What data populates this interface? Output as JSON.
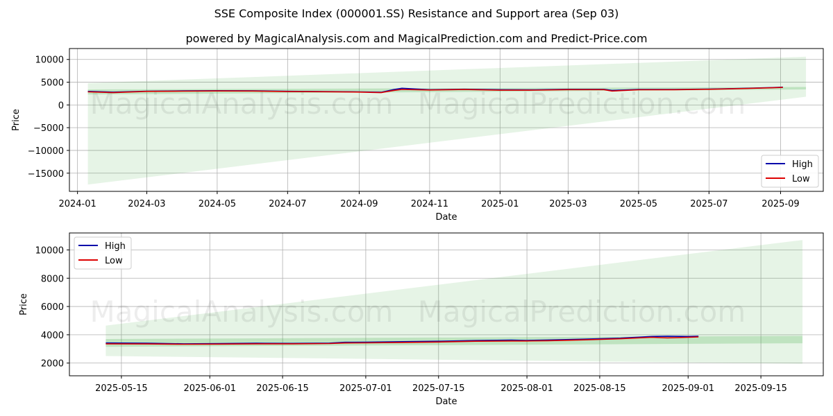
{
  "title": "SSE Composite Index (000001.SS) Resistance and Support area (Sep 03)",
  "subtitle": "powered by MagicalAnalysis.com and MagicalPrediction.com and Predict-Price.com",
  "watermarks": [
    "MagicalAnalysis.com",
    "MagicalPrediction.com"
  ],
  "colors": {
    "high": "#0000aa",
    "low": "#dd0000",
    "band": "#4caf50",
    "grid": "#b0b0b0"
  },
  "chart_data": [
    {
      "type": "line",
      "xlabel": "Date",
      "ylabel": "Price",
      "xlim": [
        "2023-12-25",
        "2025-10-08"
      ],
      "ylim": [
        -19000,
        12400
      ],
      "xticks": [
        "2024-01",
        "2024-03",
        "2024-05",
        "2024-07",
        "2024-09",
        "2024-11",
        "2025-01",
        "2025-03",
        "2025-05",
        "2025-07",
        "2025-09"
      ],
      "xtick_dates": [
        "2024-01-01",
        "2024-03-01",
        "2024-05-01",
        "2024-07-01",
        "2024-09-01",
        "2024-11-01",
        "2025-01-01",
        "2025-03-01",
        "2025-05-01",
        "2025-07-01",
        "2025-09-01"
      ],
      "yticks": [
        10000,
        5000,
        0,
        -5000,
        -10000,
        -15000
      ],
      "ytick_labels": [
        "10000",
        "5000",
        "0",
        "−5000",
        "−10000",
        "−15000"
      ],
      "grid": true,
      "legend": "lower-right",
      "dates": [
        "2024-01-10",
        "2024-02-01",
        "2024-03-01",
        "2024-04-01",
        "2024-05-01",
        "2024-06-01",
        "2024-07-01",
        "2024-08-01",
        "2024-09-01",
        "2024-09-20",
        "2024-10-01",
        "2024-10-08",
        "2024-11-01",
        "2024-12-01",
        "2025-01-01",
        "2025-02-01",
        "2025-03-01",
        "2025-04-01",
        "2025-04-08",
        "2025-05-01",
        "2025-06-01",
        "2025-07-01",
        "2025-08-01",
        "2025-08-25",
        "2025-09-03"
      ],
      "series": [
        {
          "name": "High",
          "values": [
            2980,
            2810,
            3030,
            3090,
            3130,
            3110,
            3000,
            2950,
            2870,
            2780,
            3380,
            3670,
            3350,
            3460,
            3350,
            3320,
            3430,
            3430,
            3200,
            3390,
            3400,
            3480,
            3650,
            3820,
            3910
          ]
        },
        {
          "name": "Low",
          "values": [
            2880,
            2700,
            2980,
            3020,
            3070,
            3050,
            2940,
            2900,
            2830,
            2700,
            3200,
            3400,
            3280,
            3390,
            3240,
            3250,
            3360,
            3360,
            3050,
            3330,
            3340,
            3430,
            3600,
            3770,
            3850
          ]
        }
      ],
      "bands": [
        {
          "dates": [
            "2024-01-10",
            "2025-09-23"
          ],
          "lower": [
            -17500,
            1800
          ],
          "upper": [
            4800,
            10600
          ],
          "opacity": 0.14
        },
        {
          "dates": [
            "2024-01-10",
            "2025-09-23"
          ],
          "lower": [
            2300,
            3400
          ],
          "upper": [
            3400,
            3950
          ],
          "opacity": 0.25
        }
      ]
    },
    {
      "type": "line",
      "xlabel": "Date",
      "ylabel": "Price",
      "xlim": [
        "2025-05-05",
        "2025-09-27"
      ],
      "ylim": [
        1100,
        11200
      ],
      "xticks": [
        "2025-05-15",
        "2025-06-01",
        "2025-06-15",
        "2025-07-01",
        "2025-07-15",
        "2025-08-01",
        "2025-08-15",
        "2025-09-01",
        "2025-09-15"
      ],
      "yticks": [
        10000,
        8000,
        6000,
        4000,
        2000
      ],
      "ytick_labels": [
        "10000",
        "8000",
        "6000",
        "4000",
        "2000"
      ],
      "grid": true,
      "legend": "upper-left",
      "dates": [
        "2025-05-12",
        "2025-05-20",
        "2025-05-27",
        "2025-06-03",
        "2025-06-10",
        "2025-06-17",
        "2025-06-24",
        "2025-06-27",
        "2025-07-01",
        "2025-07-08",
        "2025-07-15",
        "2025-07-22",
        "2025-07-29",
        "2025-08-01",
        "2025-08-05",
        "2025-08-12",
        "2025-08-19",
        "2025-08-25",
        "2025-08-28",
        "2025-09-01",
        "2025-09-03"
      ],
      "series": [
        {
          "name": "High",
          "values": [
            3420,
            3400,
            3360,
            3380,
            3400,
            3390,
            3410,
            3470,
            3480,
            3510,
            3540,
            3590,
            3620,
            3600,
            3630,
            3690,
            3760,
            3880,
            3900,
            3880,
            3900
          ]
        },
        {
          "name": "Low",
          "values": [
            3360,
            3350,
            3330,
            3340,
            3360,
            3360,
            3380,
            3420,
            3430,
            3460,
            3490,
            3540,
            3560,
            3560,
            3580,
            3640,
            3720,
            3820,
            3780,
            3820,
            3850
          ]
        }
      ],
      "bands": [
        {
          "dates": [
            "2025-05-12",
            "2025-09-23"
          ],
          "lower": [
            2500,
            1950
          ],
          "upper": [
            4650,
            10700
          ],
          "opacity": 0.14
        },
        {
          "dates": [
            "2025-05-12",
            "2025-09-23"
          ],
          "lower": [
            3150,
            3400
          ],
          "upper": [
            3700,
            3920
          ],
          "opacity": 0.25
        }
      ]
    }
  ]
}
